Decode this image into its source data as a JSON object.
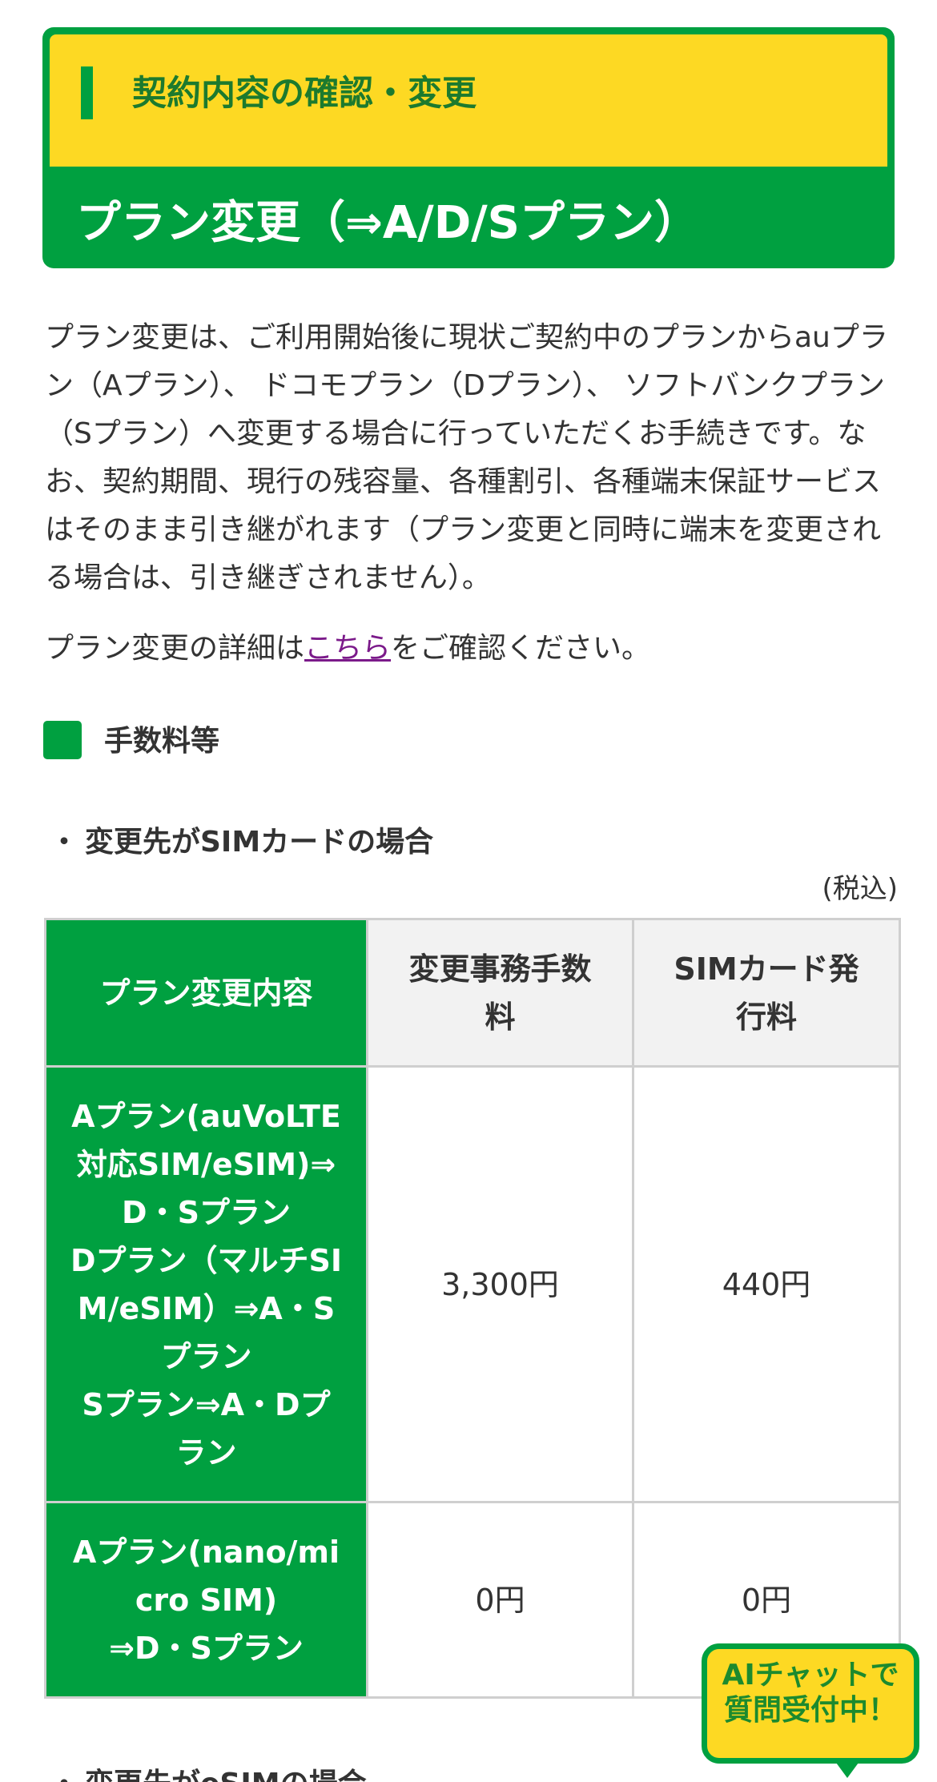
{
  "header": {
    "subtitle": "契約内容の確認・変更",
    "title": "プラン変更（⇒A/D/Sプラン）"
  },
  "intro": "プラン変更は、ご利用開始後に現状ご契約中のプランからauプラン（Aプラン）、 ドコモプラン（Dプラン）、 ソフトバンクプラン（Sプラン）へ変更する場合に行っていただくお手続きです。なお、契約期間、現行の残容量、各種割引、各種端末保証サービスはそのまま引き継がれます（プラン変更と同時に端末を変更される場合は、引き継ぎされません）。",
  "detail": {
    "prefix": "プラン変更の詳細は",
    "link": "こちら",
    "suffix": "をご確認ください。"
  },
  "section": {
    "title": "手数料等"
  },
  "sim_section": {
    "bullet": "・",
    "title": "変更先がSIMカードの場合",
    "tax_note": "(税込)"
  },
  "table": {
    "headers": [
      "プラン変更内容",
      "変更事務手数料",
      "SIMカード発行料"
    ],
    "rows": [
      {
        "plan_lines": [
          "Aプラン(auVoLTE対応SIM/eSIM)⇒D・Sプラン",
          "Dプラン（マルチSIM/eSIM）⇒A・Sプラン",
          "Sプラン⇒A・Dプラン"
        ],
        "fee": "3,300円",
        "sim_fee": "440円"
      },
      {
        "plan_lines": [
          "Aプラン(nano/micro SIM)",
          "⇒D・Sプラン"
        ],
        "fee": "0円",
        "sim_fee": "0円"
      }
    ]
  },
  "esim_section": {
    "bullet": "・",
    "title": "変更先がeSIMの場合"
  },
  "ai_chat": {
    "line1": "AIチャットで",
    "line2": "質問受付中！"
  }
}
